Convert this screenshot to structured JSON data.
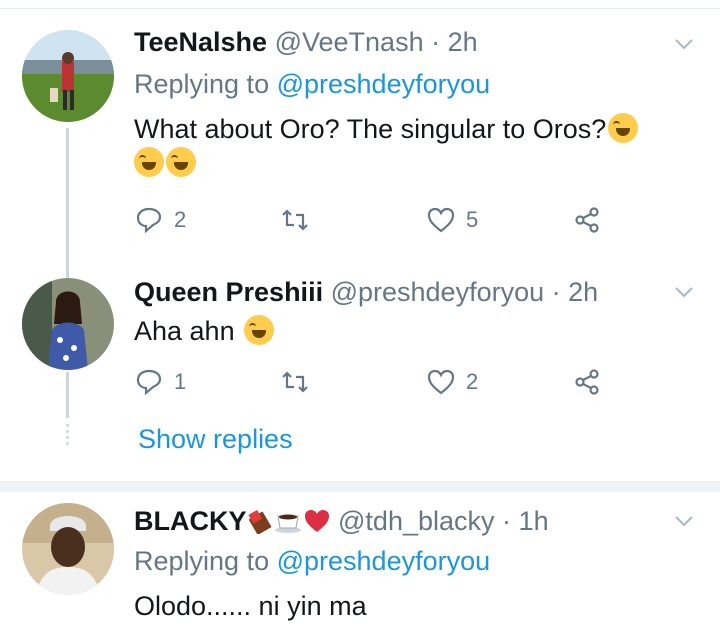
{
  "tweets": [
    {
      "name": "TeeNalshe",
      "handle": "@VeeTnash",
      "sep": "·",
      "time": "2h",
      "replying_prefix": "Replying to",
      "replying_to": "@preshdeyforyou",
      "text_line1": "What about Oro? The singular to Oros?",
      "text_line2": "",
      "reply_count": "2",
      "retweet_count": "",
      "like_count": "5"
    },
    {
      "name": "Queen Preshiii",
      "handle": "@preshdeyforyou",
      "sep": "·",
      "time": "2h",
      "text_line1": "Aha ahn",
      "reply_count": "1",
      "retweet_count": "",
      "like_count": "2"
    },
    {
      "name": "BLACKY",
      "handle": "@tdh_blacky",
      "sep": "·",
      "time": "1h",
      "replying_prefix": "Replying to",
      "replying_to": "@preshdeyforyou",
      "text_line1": "Olodo...... ni yin ma"
    }
  ],
  "show_replies": "Show replies",
  "colors": {
    "link": "#1b95e0",
    "muted": "#657786",
    "divider": "#e6ecf0"
  }
}
